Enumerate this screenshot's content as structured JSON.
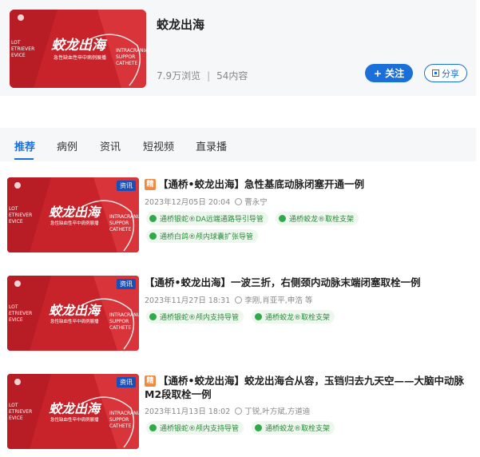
{
  "header": {
    "title": "蛟龙出海",
    "views": "7.9万浏览",
    "separator": "|",
    "count": "54内容",
    "follow_label": "+ 关注",
    "share_label": "分享"
  },
  "cover": {
    "calligraphy": "蛟龙出海",
    "subtitle": "急性缺血性卒中病例展播",
    "side_left": [
      "LOT",
      "ETRIEVER",
      "EVICE"
    ],
    "side_right": [
      "INTRACRANIA",
      "SUPPOR",
      "CATHETE"
    ]
  },
  "tabs": [
    "推荐",
    "病例",
    "资讯",
    "短视频",
    "直录播"
  ],
  "items": [
    {
      "badge": "资讯",
      "jing": "精",
      "title": "【通桥•蛟龙出海】急性基底动脉闭塞开通一例",
      "date": "2023年12月05日 20:04",
      "author": "曹永宁",
      "tags": [
        "通桥银蛇®DA远端通路导引导管",
        "通桥蛟龙®取栓支架",
        "通桥白鸽®颅内球囊扩张导管"
      ]
    },
    {
      "badge": "资讯",
      "jing": "",
      "title": "【通桥•蛟龙出海】一波三折，右侧颈内动脉末端闭塞取栓一例",
      "date": "2023年11月27日 18:31",
      "author": "李刚,肖亚平,申浩 等",
      "tags": [
        "通桥银蛇®颅内支持导管",
        "通桥蛟龙®取栓支架"
      ]
    },
    {
      "badge": "资讯",
      "jing": "精",
      "title": "【通桥•蛟龙出海】蛟龙出海合从容，玉铛归去九天空——大脑中动脉M2段取栓一例",
      "date": "2023年11月13日 18:02",
      "author": "丁锐,叶方斌,方道迪",
      "tags": [
        "通桥银蛇®颅内支持导管",
        "通桥蛟龙®取栓支架"
      ]
    }
  ],
  "colors": {
    "accent": "#1a6fd8",
    "cover_red": "#c8222a",
    "tag_green": "#2eaa48",
    "jing_orange": "#f08a3e"
  }
}
